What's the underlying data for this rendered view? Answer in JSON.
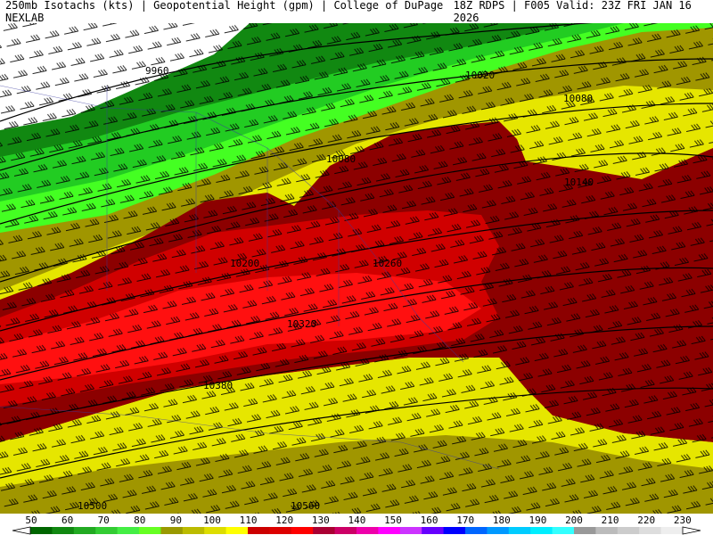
{
  "header": {
    "left": "250mb Isotachs (kts) | Geopotential Height (gpm) | College of DuPage NEXLAB",
    "right": "18Z RDPS | F005 Valid: 23Z FRI JAN 16 2026"
  },
  "map": {
    "contour_labels": [
      "9960",
      "10020",
      "10080",
      "10080",
      "10140",
      "10200",
      "10260",
      "10320",
      "10380",
      "10500",
      "10560"
    ]
  },
  "colorbar": {
    "ticks": [
      "50",
      "60",
      "70",
      "80",
      "90",
      "100",
      "110",
      "120",
      "130",
      "140",
      "150",
      "160",
      "170",
      "180",
      "190",
      "200",
      "210",
      "220",
      "230"
    ],
    "colors": [
      "#006600",
      "#118811",
      "#22aa22",
      "#33cc33",
      "#44ee44",
      "#66ff22",
      "#999900",
      "#bbbb00",
      "#dddd00",
      "#ffff00",
      "#cc0000",
      "#dd0000",
      "#ff0000",
      "#aa0033",
      "#cc0066",
      "#ee00aa",
      "#ff00ff",
      "#cc33ff",
      "#6600ff",
      "#0000ff",
      "#0066ff",
      "#0099ff",
      "#00ccff",
      "#00eeff",
      "#33ffff",
      "#999999",
      "#bbbbbb",
      "#cccccc",
      "#dddddd",
      "#eeeeee"
    ]
  },
  "colors": {
    "high_red": "#8c0000",
    "red": "#c80000",
    "yellow": "#f0f000",
    "olive": "#a09600",
    "green": "#22cc22",
    "bright_green": "#44ff22",
    "dark_green": "#118811"
  }
}
